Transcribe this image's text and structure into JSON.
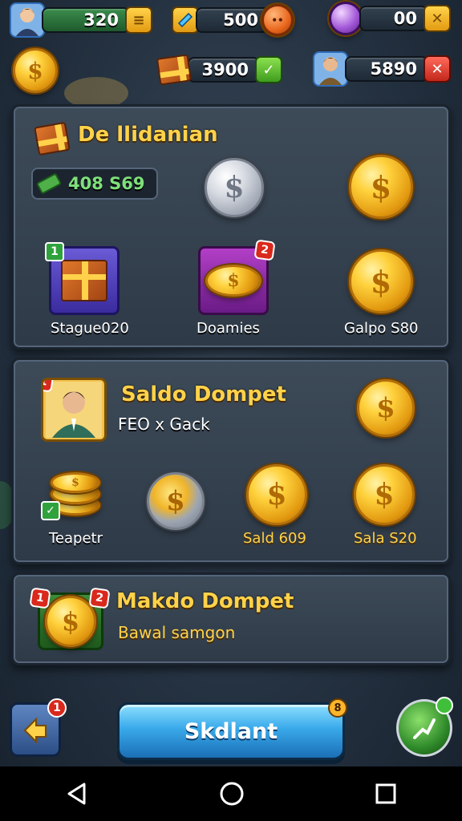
{
  "topbar": {
    "player_score": "320",
    "gems": "500",
    "orbs": "00",
    "chests": "3900",
    "friends": "5890"
  },
  "panel1": {
    "title": "De llidanian",
    "cash": "408 S69",
    "items": [
      {
        "label": "Stague020",
        "badge": "1"
      },
      {
        "label": "Doamies",
        "badge": "2"
      },
      {
        "label": "Galpo S80"
      }
    ]
  },
  "panel2": {
    "title": "Saldo Dompet",
    "subtitle": "FEO x Gack",
    "badge": "1",
    "items": [
      {
        "label": "Teapetr"
      },
      {
        "label": ""
      },
      {
        "label": "Sald 609"
      },
      {
        "label": "Sala S20"
      }
    ]
  },
  "panel3": {
    "title": "Makdo Dompet",
    "subtitle": "Bawal samgon",
    "badges": [
      "1",
      "2"
    ]
  },
  "bottom": {
    "back_badge": "1",
    "main_button": "Skdlant",
    "main_badge": "8"
  },
  "colors": {
    "accent_gold": "#ffd24a",
    "panel": "#3d4a58",
    "button_blue": "#39a9ea"
  }
}
